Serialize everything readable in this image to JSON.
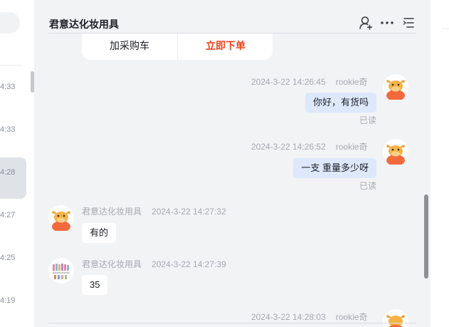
{
  "left_list": {
    "times": [
      "4:33",
      "4:33",
      "4:28",
      "4:27",
      "4:25",
      "4:19"
    ]
  },
  "chat": {
    "title": "君意达化妆用具",
    "order_card": {
      "add_label": "加采购车",
      "buy_label": "立即下单"
    },
    "messages": [
      {
        "side": "right",
        "time": "2024-3-22 14:26:45",
        "sender": "rookie奇",
        "text": "你好，有货吗",
        "read": "已读",
        "avatar": "cow-avatar-icon"
      },
      {
        "side": "right",
        "time": "2024-3-22 14:26:52",
        "sender": "rookie奇",
        "text": "一支  重量多少呀",
        "read": "已读",
        "avatar": "cow-avatar-icon"
      },
      {
        "side": "left",
        "time": "2024-3-22 14:27:32",
        "sender": "君意达化妆用具",
        "text": "有的",
        "avatar": "cow-avatar-icon"
      },
      {
        "side": "left",
        "time": "2024-3-22 14:27:39",
        "sender": "君意达化妆用具",
        "text": "35",
        "avatar": "brushes-avatar-icon"
      },
      {
        "side": "right",
        "time": "2024-3-22 14:28:03",
        "sender": "rookie奇",
        "avatar": "cow-avatar-icon"
      }
    ]
  },
  "colors": {
    "accent_red": "#e8451e",
    "bubble_right": "#dde8fd",
    "chat_bg": "#f2f3f5"
  },
  "icons": [
    "add-contact-icon",
    "more-icon",
    "list-icon"
  ]
}
